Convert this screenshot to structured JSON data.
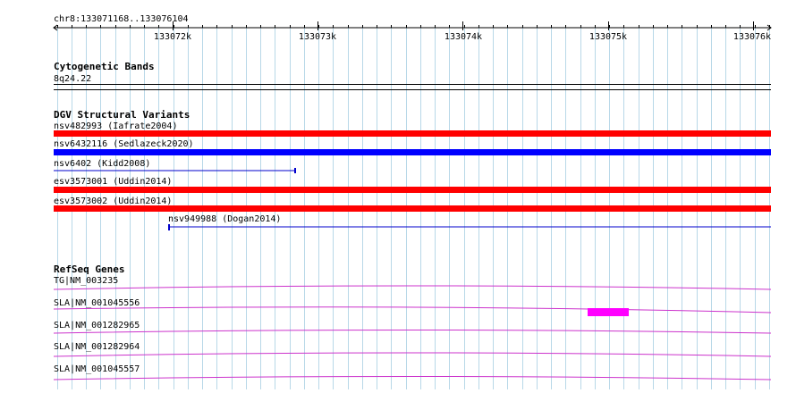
{
  "ruler": {
    "location": "chr8:133071168..133076104",
    "ticks": [
      "133072k",
      "133073k",
      "133074k",
      "133075k",
      "133076k"
    ]
  },
  "tracks": {
    "cytoband": {
      "title": "Cytogenetic Bands",
      "band_label": "8q24.22"
    },
    "dgv": {
      "title": "DGV Structural Variants",
      "features": [
        {
          "label": "nsv482993 (Iafrate2004)",
          "color": "#ff0000"
        },
        {
          "label": "nsv6432116 (Sedlazeck2020)",
          "color": "#0000ff"
        },
        {
          "label": "nsv6402 (Kidd2008)",
          "color": "#0000cc"
        },
        {
          "label": "esv3573001 (Uddin2014)",
          "color": "#ff0000"
        },
        {
          "label": "esv3573002 (Uddin2014)",
          "color": "#ff0000"
        },
        {
          "label": "nsv949988 (Dogan2014)",
          "color": "#0000cc"
        }
      ]
    },
    "refseq": {
      "title": "RefSeq Genes",
      "color": "#cc33cc",
      "exon_color": "#ff00ff",
      "transcripts": [
        {
          "label": "TG|NM_003235"
        },
        {
          "label": "SLA|NM_001045556"
        },
        {
          "label": "SLA|NM_001282965"
        },
        {
          "label": "SLA|NM_001282964"
        },
        {
          "label": "SLA|NM_001045557"
        }
      ]
    }
  },
  "colors": {
    "grid": "#b8d8e8",
    "ruler_line": "#000000",
    "cyto_band": "#000000"
  }
}
